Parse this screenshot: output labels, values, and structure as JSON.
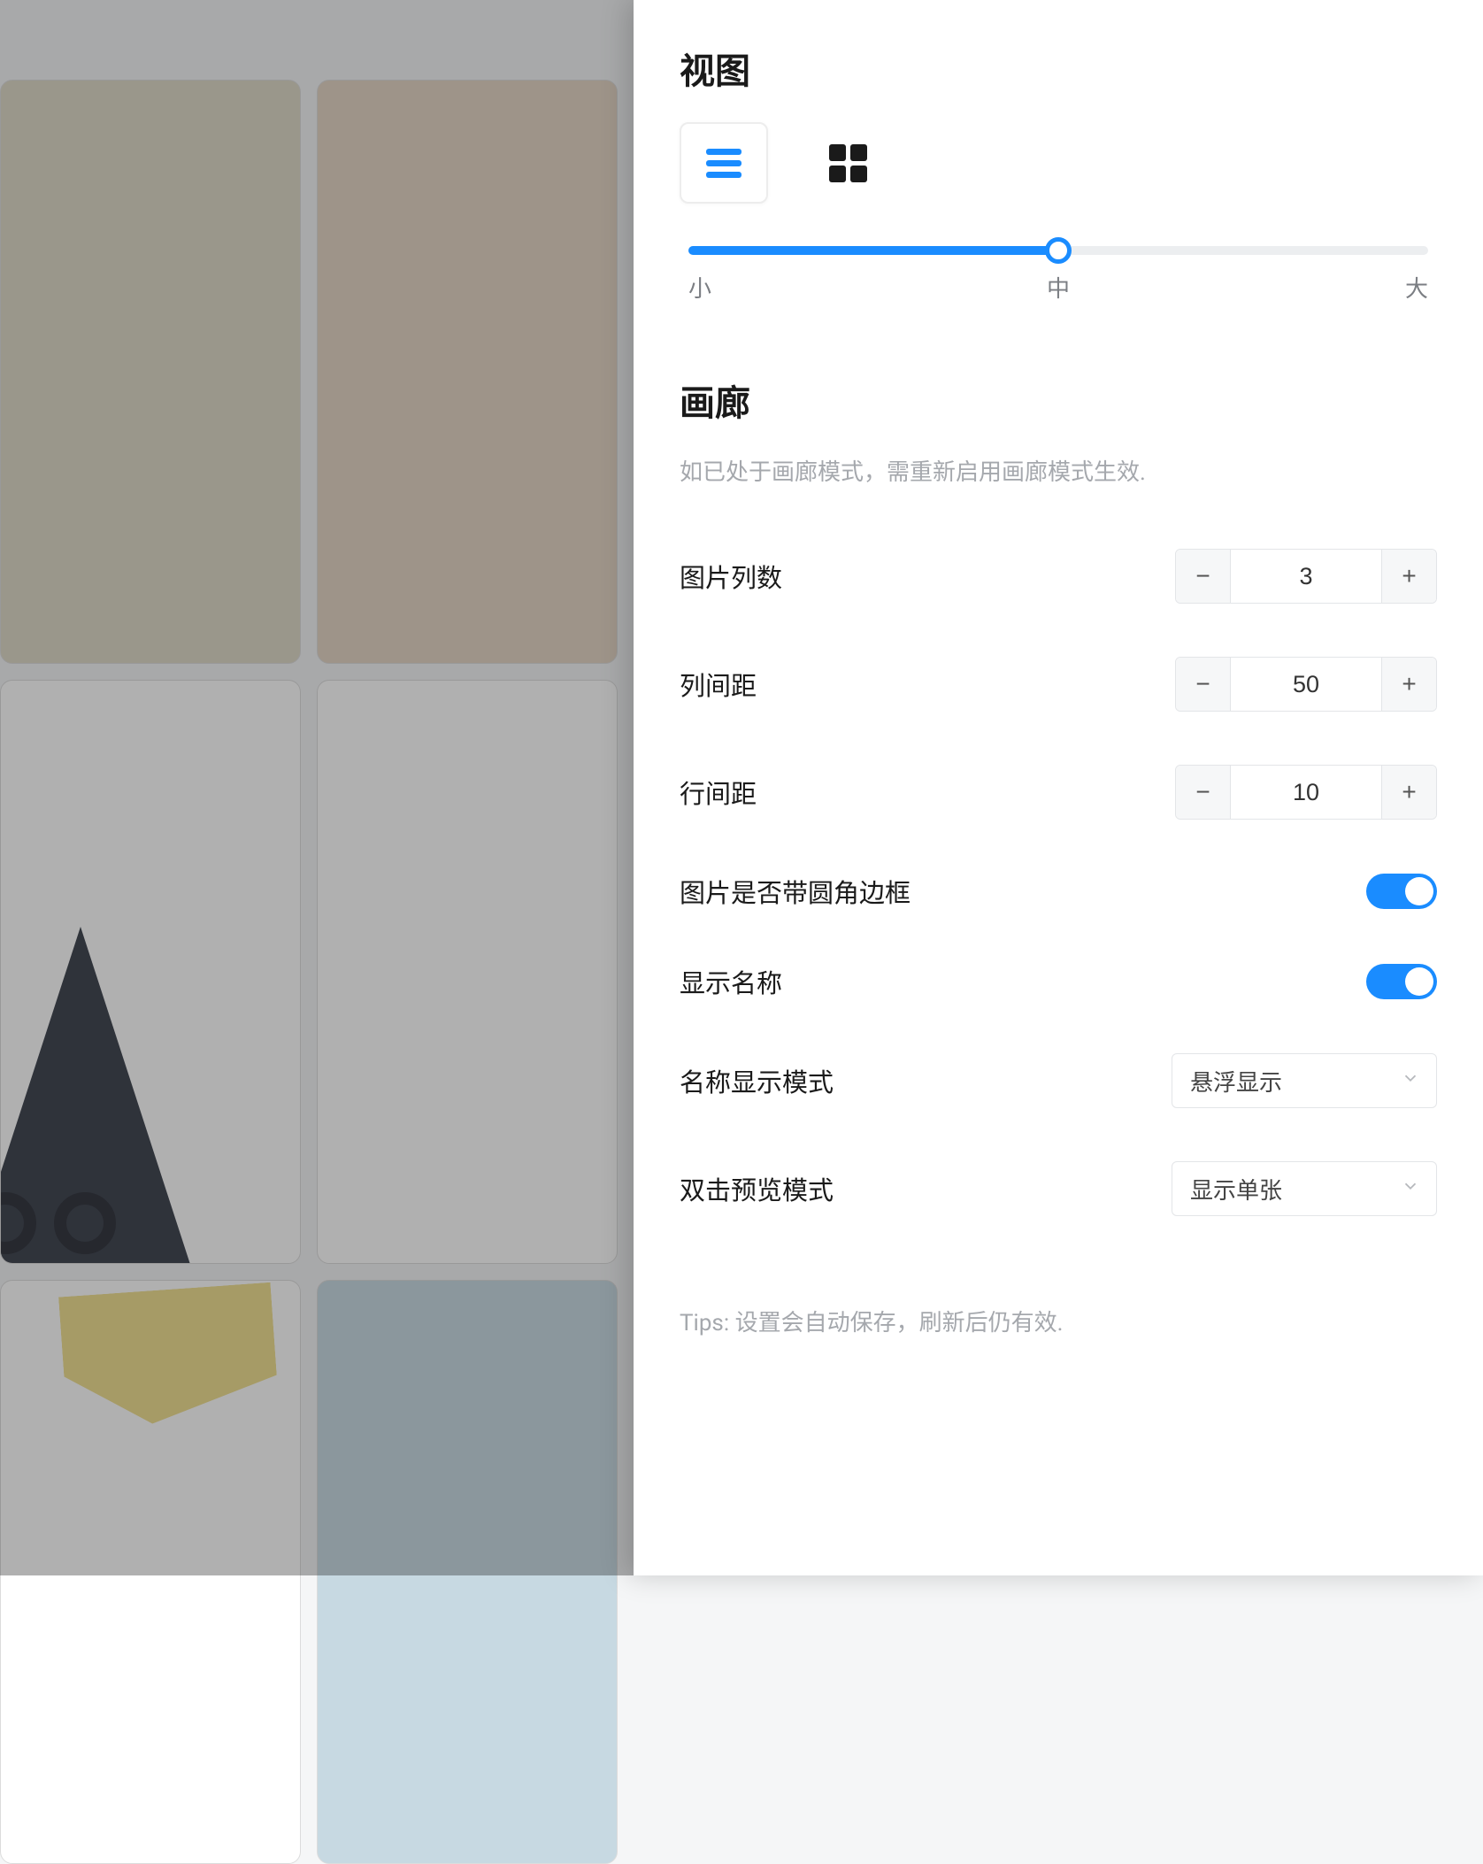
{
  "view": {
    "title": "视图",
    "slider": {
      "label_small": "小",
      "label_medium": "中",
      "label_large": "大",
      "value_percent": 50
    }
  },
  "gallery": {
    "title": "画廊",
    "hint": "如已处于画廊模式，需重新启用画廊模式生效.",
    "rows": {
      "columns": {
        "label": "图片列数",
        "value": "3"
      },
      "col_gap": {
        "label": "列间距",
        "value": "50"
      },
      "row_gap": {
        "label": "行间距",
        "value": "10"
      },
      "rounded": {
        "label": "图片是否带圆角边框",
        "on": true
      },
      "show_name": {
        "label": "显示名称",
        "on": true
      },
      "name_mode": {
        "label": "名称显示模式",
        "value": "悬浮显示"
      },
      "dblclick_mode": {
        "label": "双击预览模式",
        "value": "显示单张"
      }
    }
  },
  "tips": "Tips: 设置会自动保存，刷新后仍有效."
}
